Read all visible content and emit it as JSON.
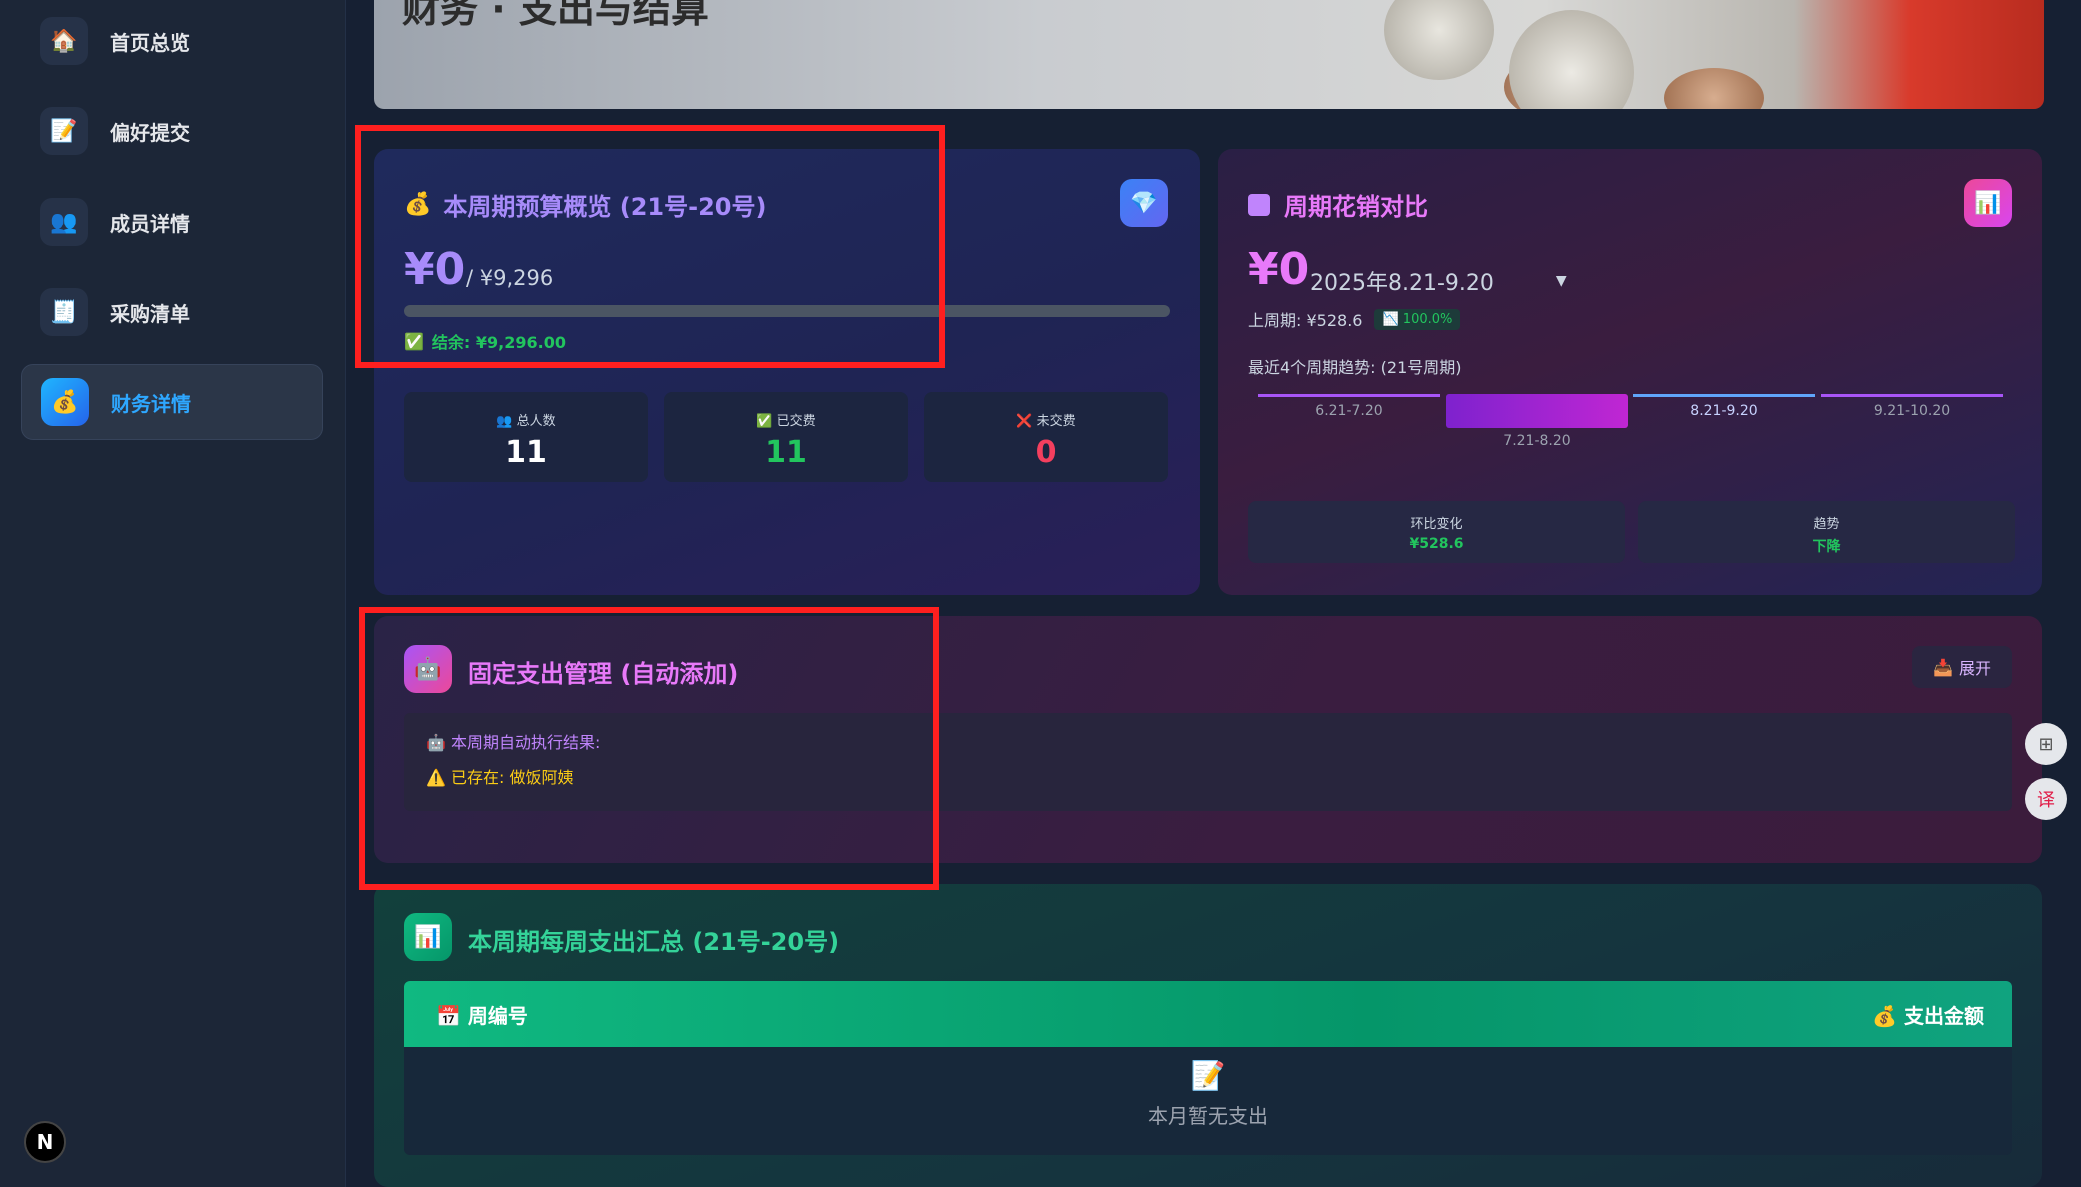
{
  "sidebar": {
    "items": [
      {
        "icon": "🏠",
        "label": "首页总览"
      },
      {
        "icon": "📝",
        "label": "偏好提交"
      },
      {
        "icon": "👥",
        "label": "成员详情"
      },
      {
        "icon": "🧾",
        "label": "采购清单"
      },
      {
        "icon": "💰",
        "label": "财务详情"
      }
    ],
    "active_index": 4
  },
  "hero": {
    "title": "财务 · 支出与结算"
  },
  "budget": {
    "title": "本周期预算概览 (21号-20号)",
    "amount": "¥0",
    "total": "/ ¥9,296",
    "progress_fraction": 0,
    "balance": "结余: ¥9,296.00",
    "stats": [
      {
        "icon": "👥",
        "label": "总人数",
        "value": "11",
        "color": "#ffffff"
      },
      {
        "icon": "✅",
        "label": "已交费",
        "value": "11",
        "color": "#22c55e"
      },
      {
        "icon": "❌",
        "label": "未交费",
        "value": "0",
        "color": "#f43f5e"
      }
    ]
  },
  "compare": {
    "title": "周期花销对比",
    "amount": "¥0",
    "period": "2025年8.21-9.20",
    "dropdown_arrow": "▼",
    "last_period": "上周期: ¥528.6",
    "change_badge": "100.0%",
    "trend_label": "最近4个周期趋势: (21号周期)",
    "periods": [
      "6.21-7.20",
      "7.21-8.20",
      "8.21-9.20",
      "9.21-10.20"
    ],
    "mom_label": "环比变化",
    "mom_value": "¥528.6",
    "trend_title": "趋势",
    "trend_value": "下降"
  },
  "fixed": {
    "title": "固定支出管理 (自动添加)",
    "expand": "展开",
    "exec_title": "本周期自动执行结果:",
    "exec_line": "已存在: 做饭阿姨"
  },
  "summary": {
    "title": "本周期每周支出汇总 (21号-20号)",
    "col_week": "周编号",
    "col_amount": "支出金额",
    "empty_text": "本月暂无支出"
  },
  "colors": {
    "budget_title": "#a78bfa",
    "compare_title": "#e879f9",
    "summary_title": "#34d399",
    "accent_green": "#22c55e",
    "warning": "#facc15"
  }
}
